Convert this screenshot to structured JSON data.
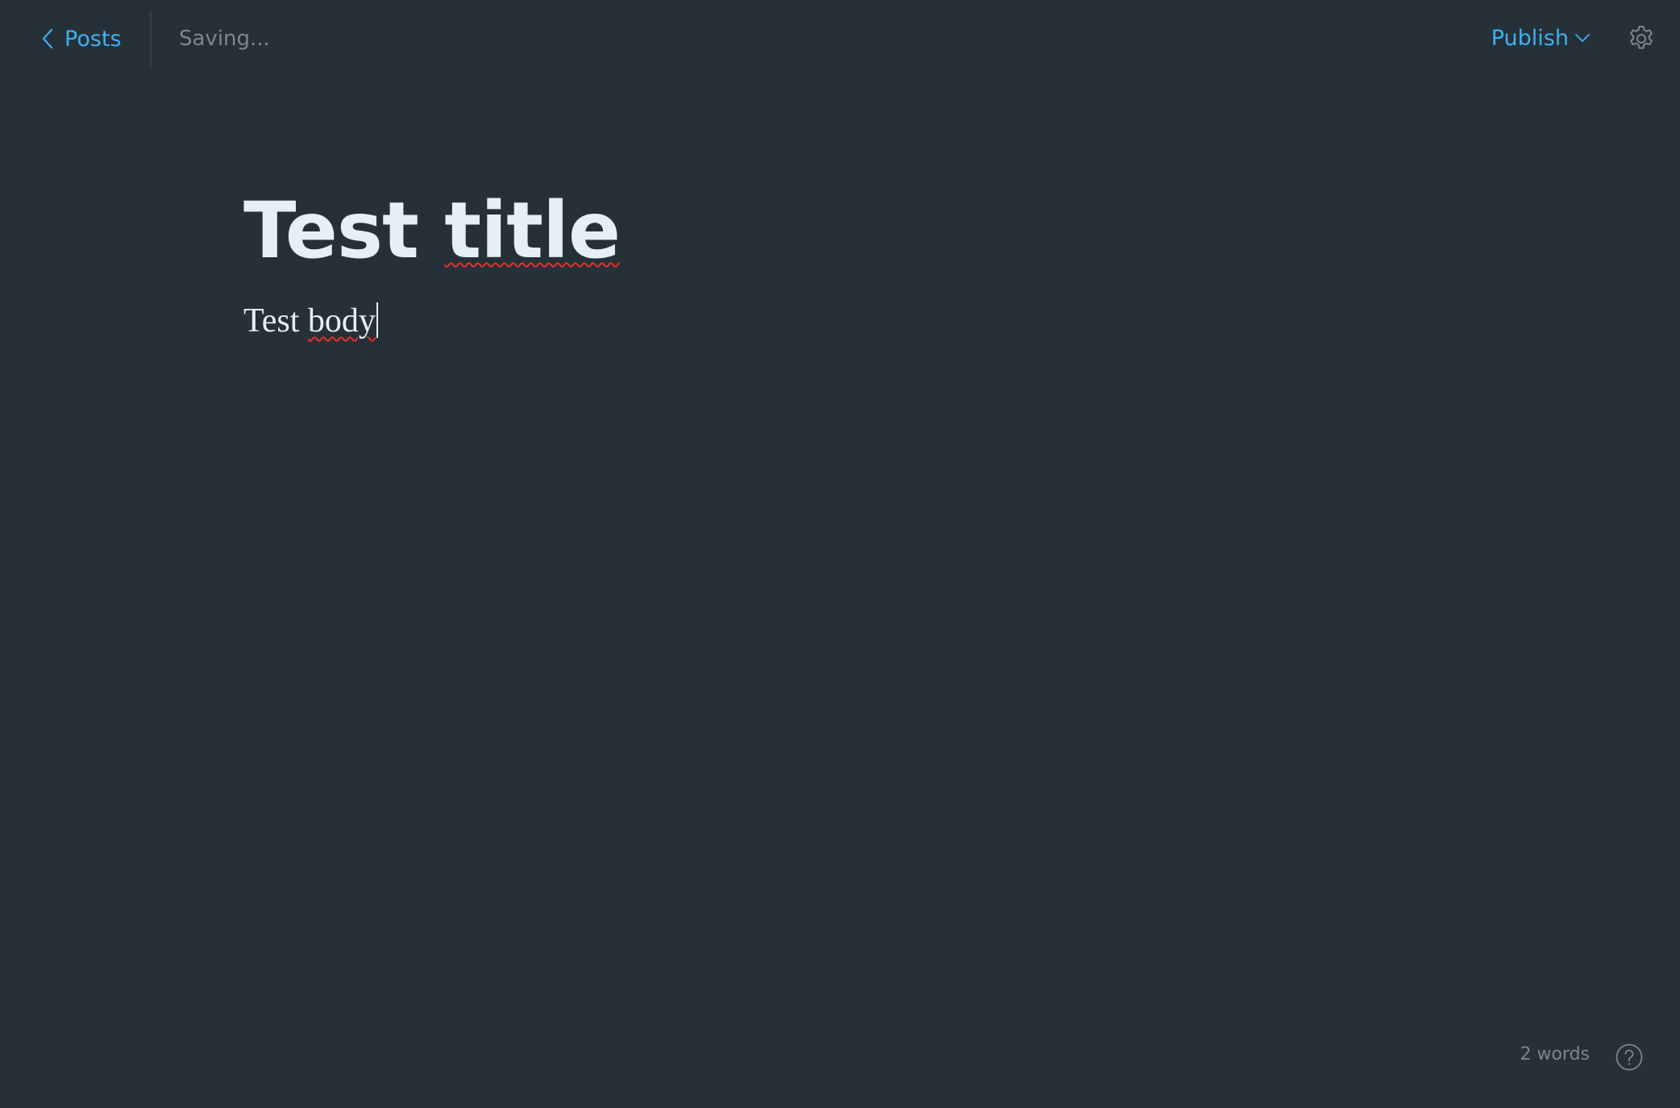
{
  "topbar": {
    "back_label": "Posts",
    "status": "Saving...",
    "publish_label": "Publish"
  },
  "editor": {
    "title_part1": "Test ",
    "title_part2": "title",
    "body_part1": "Test ",
    "body_part2": "body"
  },
  "footer": {
    "word_count": "2 words"
  },
  "icons": {
    "back": "chevron-left-icon",
    "publish_dropdown": "chevron-down-icon",
    "settings": "gear-icon",
    "help": "question-circle-icon"
  },
  "colors": {
    "background": "#263038",
    "accent": "#3eb0ef",
    "text": "#e5eff5",
    "muted": "#7d878a",
    "spellcheck": "#e62e2e"
  }
}
